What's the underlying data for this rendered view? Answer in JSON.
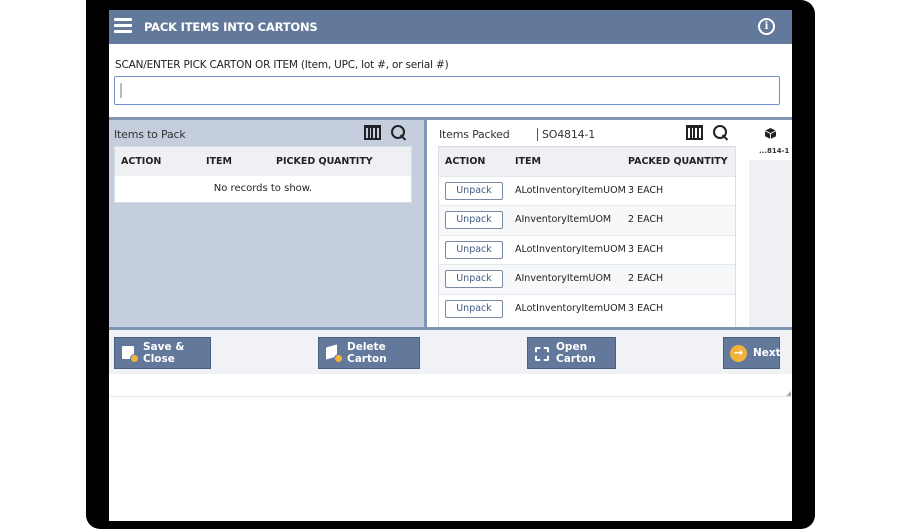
{
  "header": {
    "title": "PACK ITEMS INTO CARTONS",
    "menu_icon": "hamburger-menu-icon",
    "info_icon": "info-icon",
    "info_glyph": "i"
  },
  "scan": {
    "label": "SCAN/ENTER PICK CARTON OR ITEM (Item, UPC, lot #, or serial #)",
    "value": "",
    "placeholder": ""
  },
  "items_to_pack": {
    "title": "Items to Pack",
    "columns": [
      "ACTION",
      "ITEM",
      "PICKED QUANTITY"
    ],
    "empty_message": "No records to show."
  },
  "items_packed": {
    "title": "Items Packed",
    "carton_id": "SO4814-1",
    "columns": [
      "ACTION",
      "ITEM",
      "PACKED QUANTITY"
    ],
    "rows": [
      {
        "action": "Unpack",
        "item": "ALotInventoryItemUOM",
        "qty": "3 EACH"
      },
      {
        "action": "Unpack",
        "item": "AInventoryItemUOM",
        "qty": "2 EACH"
      },
      {
        "action": "Unpack",
        "item": "ALotInventoryItemUOM",
        "qty": "3 EACH"
      },
      {
        "action": "Unpack",
        "item": "AInventoryItemUOM",
        "qty": "2 EACH"
      },
      {
        "action": "Unpack",
        "item": "ALotInventoryItemUOM",
        "qty": "3 EACH"
      }
    ]
  },
  "carton_tab": {
    "label": "...814-1",
    "icon": "carton-box-icon"
  },
  "actions": {
    "save_close": "Save & Close",
    "delete_carton": "Delete Carton",
    "open_carton_line1": "Open",
    "open_carton_line2": "Carton",
    "next": "Next",
    "next_glyph": "→"
  },
  "colors": {
    "header_bg": "#63799b",
    "panel_bg": "#c5cedd",
    "accent_orange": "#f2b33d",
    "input_border": "#6e8fd0"
  }
}
